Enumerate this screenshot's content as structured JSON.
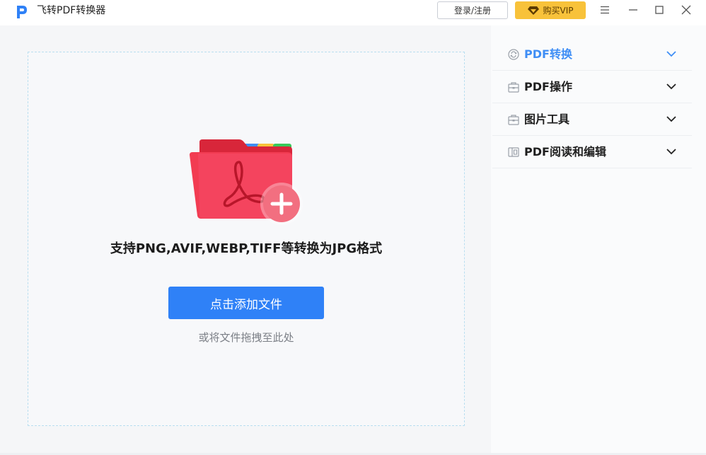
{
  "titlebar": {
    "app_name": "飞转PDF转换器",
    "login_label": "登录/注册",
    "vip_label": "购买VIP",
    "logo_icon": "app-logo-icon",
    "vip_icon": "diamond-icon",
    "menu_icon": "hamburger-menu-icon",
    "minimize_icon": "minimize-icon",
    "maximize_icon": "maximize-icon",
    "close_icon": "close-icon"
  },
  "upload": {
    "support_text": "支持PNG,AVIF,WEBP,TIFF等转换为JPG格式",
    "add_button_label": "点击添加文件",
    "drag_hint": "或将文件拖拽至此处",
    "folder_icon": "pdf-folder-add-icon"
  },
  "sidebar": {
    "items": [
      {
        "label": "PDF转换",
        "icon": "convert-icon",
        "active": true
      },
      {
        "label": "PDF操作",
        "icon": "toolbox-icon",
        "active": false
      },
      {
        "label": "图片工具",
        "icon": "toolbox-icon",
        "active": false
      },
      {
        "label": "PDF阅读和编辑",
        "icon": "reader-icon",
        "active": false
      }
    ]
  },
  "colors": {
    "accent": "#2f81f7",
    "active_text": "#3f8ef5",
    "vip_gold": "#f8c23a",
    "folder_red": "#f0364c"
  }
}
